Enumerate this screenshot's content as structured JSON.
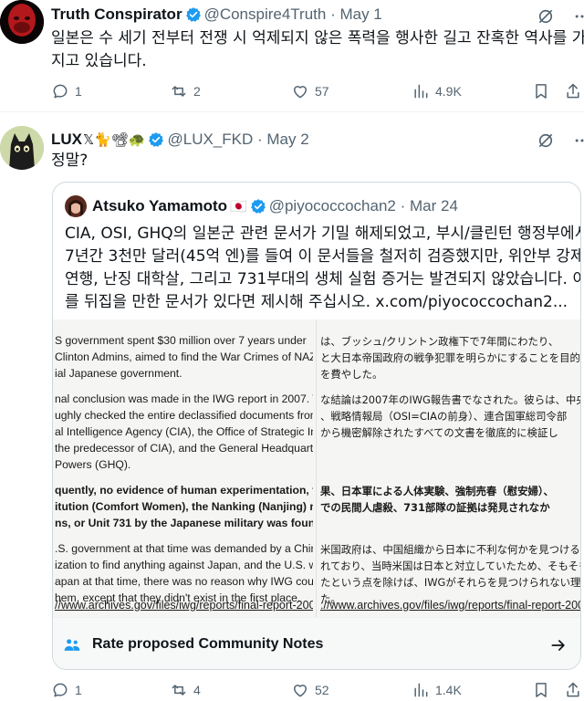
{
  "tweet1": {
    "display_name": "Truth Conspirator",
    "handle": "@Conspire4Truth",
    "date": "May 1",
    "text_line1": "일본은 수 세기 전부터 전쟁 시 억제되지 않은 폭력을 행사한 길고 잔혹한 역사를 가",
    "text_line2": "지고 있습니다.",
    "replies": "1",
    "reposts": "2",
    "likes": "57",
    "views": "4.9K"
  },
  "tweet2": {
    "display_name": "LUX",
    "name_emoji": "𝕏🐈📽🐢",
    "handle": "@LUX_FKD",
    "date": "May 2",
    "text": "정말?",
    "replies": "1",
    "reposts": "4",
    "likes": "52",
    "views": "1.4K"
  },
  "quote": {
    "display_name": "Atsuko Yamamoto",
    "flag": "🇯🇵",
    "handle": "@piyococcochan2",
    "date": "Mar 24",
    "lines": [
      "CIA, OSI, GHQ의 일본군 관련 문서가 기밀 해제되었고, 부시/클린턴 행정부에서",
      "7년간 3천만 달러(45억 엔)를 들여 이 문서들을 철저히 검증했지만, 위안부 강제",
      "연행, 난징 대학살, 그리고 731부대의 생체 실험 증거는 발견되지 않았습니다. 이",
      "를 뒤집을 만한 문서가 있다면 제시해 주십시오. x.com/piyococcochan2..."
    ],
    "doc_left": [
      {
        "t": "S government spent $30 million over 7 years under",
        "b": false
      },
      {
        "t": "Clinton Admins, aimed to find the War Crimes of NAZI a",
        "b": false
      },
      {
        "t": "ial Japanese government.",
        "b": false
      },
      {
        "t": "nal conclusion was made in the IWG report in 2007. The",
        "b": false
      },
      {
        "t": "ughly checked the entire declassified documents from th",
        "b": false
      },
      {
        "t": "al Intelligence Agency (CIA), the Office of Strategic Intell",
        "b": false
      },
      {
        "t": "the predecessor of CIA), and the General Headquarters (",
        "b": false
      },
      {
        "t": "Powers (GHQ).",
        "b": false
      },
      {
        "t": "quently, no evidence of human experimentation, force",
        "b": true
      },
      {
        "t": "itution (Comfort Women), the Nanking (Nanjing) massa",
        "b": true
      },
      {
        "t": "ns, or Unit 731 by the Japanese military was found.",
        "b": true
      },
      {
        "t": ".S. government at that time was demanded by a Chines",
        "b": false
      },
      {
        "t": "ization to find anything against Japan, and the U.S. was",
        "b": false
      },
      {
        "t": "apan at that time, there was no reason why IWG could r",
        "b": false
      },
      {
        "t": "hem, except that they didn't exist in the first place.",
        "b": false
      }
    ],
    "doc_right": [
      {
        "t": "は、ブッシュ/クリントン政権下で7年間にわたり、",
        "b": false
      },
      {
        "t": "と大日本帝国政府の戦争犯罪を明らかにすることを目的とし",
        "b": false
      },
      {
        "t": "を費やした。",
        "b": false
      },
      {
        "t": "な結論は2007年のIWG報告書でなされた。彼らは、中央",
        "b": false
      },
      {
        "t": "、戦略情報局（OSI=CIAの前身）、連合国軍総司令部",
        "b": false
      },
      {
        "t": "から機密解除されたすべての文書を徹底的に検証し",
        "b": false
      },
      {
        "t": "果、日本軍による人体実験、強制売春（慰安婦）、",
        "b": true
      },
      {
        "t": "での民間人虐殺、731部隊の証拠は発見されなか",
        "b": true
      },
      {
        "t": "米国政府は、中国組織から日本に不利な何かを見つけるよう",
        "b": false
      },
      {
        "t": "れており、当時米国は日本と対立していたため、そもそも存在",
        "b": false
      },
      {
        "t": "たという点を除けば、IWGがそれらを見つけられない理由は",
        "b": false
      },
      {
        "t": "た。",
        "b": false
      }
    ],
    "doc_url_left": "//www.archives.gov/files/iwg/reports/final-report-2007",
    "doc_url_right": "://www.archives.gov/files/iwg/reports/final-report-2007",
    "community_notes_label": "Rate proposed Community Notes"
  },
  "colors": {
    "verified": "#1d9bf0",
    "muted": "#536471",
    "text": "#0f1419",
    "border": "#cfd9de"
  }
}
